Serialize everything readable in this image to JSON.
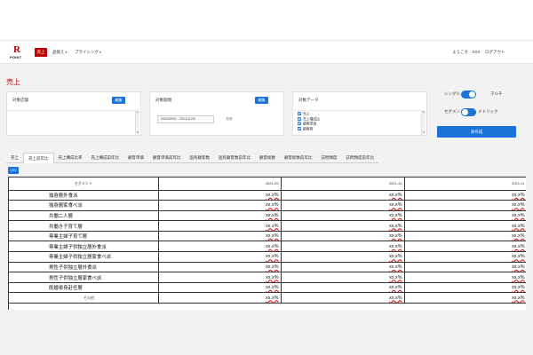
{
  "header": {
    "logo_text": "POINT",
    "logo_letter": "R",
    "nav_active": "売上",
    "nav_items": [
      "品揃え",
      "プライシング"
    ],
    "welcome": "ようこそ　XXX",
    "logout": "ログアウト"
  },
  "page_title": "売上",
  "panels": {
    "stores": {
      "label": "対象店舗",
      "button": "編集"
    },
    "period": {
      "label": "対象期間",
      "button": "編集",
      "value": "2021/09/01 - 2021/11/30",
      "note": "月次"
    },
    "data": {
      "label": "対象データ",
      "items": [
        "売上",
        "売上構成比",
        "顧客単価",
        "顧客数"
      ]
    }
  },
  "toggles": {
    "mode_left": "シングル",
    "mode_right": "マルチ",
    "view_left": "セグメント",
    "view_right": "メトリック"
  },
  "create_button": "表作成",
  "tabs": [
    "売上",
    "売上前年比",
    "売上構成比率",
    "売上構成前年比",
    "顧客単価",
    "顧客単価前年比",
    "固有顧客数",
    "固有顧客数前年比",
    "顧客総数",
    "顧客総数前年比",
    "訪問頻度",
    "訪問頻度前年比"
  ],
  "active_tab": "売上前年比",
  "csv_button": "CSV",
  "table": {
    "headers": [
      "セグメント",
      "2021-09",
      "2021-10",
      "2021-11"
    ],
    "rows": [
      {
        "segment": "独身層外食派",
        "values": [
          "xx.x%",
          "xx.x%",
          "xx.x%"
        ]
      },
      {
        "segment": "独身層家食べ派",
        "values": [
          "xx.x%",
          "xx.x%",
          "xx.x%"
        ]
      },
      {
        "segment": "共働二人層",
        "values": [
          "xx.x%",
          "xx.x%",
          "xx.x%"
        ]
      },
      {
        "segment": "共働き子育て層",
        "values": [
          "xx.x%",
          "xx.x%",
          "xx.x%"
        ]
      },
      {
        "segment": "専業主婦子育て層",
        "values": [
          "xx.x%",
          "xx.x%",
          "xx.x%"
        ]
      },
      {
        "segment": "専業主婦子供独立層外食派",
        "values": [
          "xx.x%",
          "xx.x%",
          "xx.x%"
        ]
      },
      {
        "segment": "専業主婦子供独立層家食べ派",
        "values": [
          "xx.x%",
          "xx.x%",
          "xx.x%"
        ]
      },
      {
        "segment": "男性子供独立層外食派",
        "values": [
          "xx.x%",
          "xx.x%",
          "xx.x%"
        ]
      },
      {
        "segment": "男性子供独立層家食べ派",
        "values": [
          "xx.x%",
          "xx.x%",
          "xx.x%"
        ]
      },
      {
        "segment": "既婚単身赴任層",
        "values": [
          "xx.x%",
          "xx.x%",
          "xx.x%"
        ]
      },
      {
        "segment": "その他",
        "values": [
          "xx.x%",
          "xx.x%",
          "xx.x%"
        ]
      }
    ]
  },
  "colors": {
    "brand_red": "#bf0000",
    "accent_blue": "#1a73d9"
  }
}
